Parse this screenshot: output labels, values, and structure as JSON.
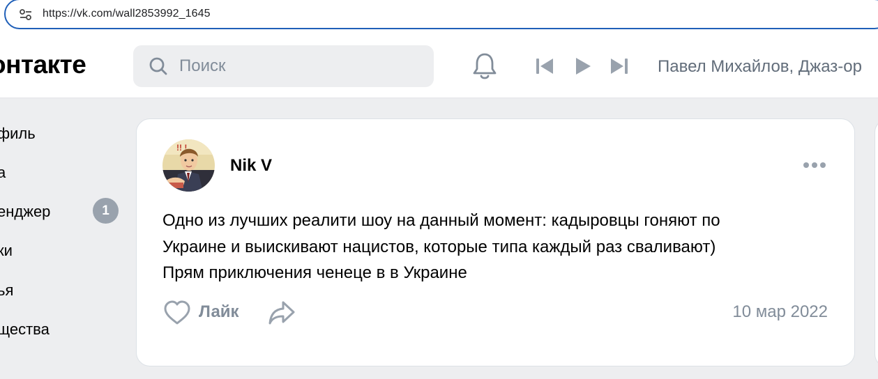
{
  "browser": {
    "url": "https://vk.com/wall2853992_1645",
    "site_info_icon": "tune-icon"
  },
  "header": {
    "logo_text": "онтакте",
    "search": {
      "placeholder": "Поиск",
      "value": ""
    },
    "icons": [
      "search-icon",
      "bell-icon",
      "skip-previous-icon",
      "play-icon",
      "skip-next-icon"
    ],
    "player_title": "Павел Михайлов, Джаз-ор"
  },
  "sidebar": {
    "items": [
      {
        "label": "филь"
      },
      {
        "label": "а"
      },
      {
        "label": "енджер",
        "badge": "1"
      },
      {
        "label": "ки"
      },
      {
        "label": "ья"
      },
      {
        "label": "щества"
      }
    ]
  },
  "post": {
    "author": "Nik V",
    "text_lines": [
      "Одно из лучших реалити шоу на данный момент: кадыровцы гоняют по",
      "Украине и выискивают нацистов, которые типа каждый раз сваливают)",
      "Прям приключения ченеце в в Украине"
    ],
    "like_label": "Лайк",
    "date": "10 мар 2022"
  },
  "colors": {
    "background": "#edeef0",
    "card": "#ffffff",
    "muted_text": "#818c99",
    "badge": "#99a2ad",
    "address_border": "#1f5fb8"
  }
}
